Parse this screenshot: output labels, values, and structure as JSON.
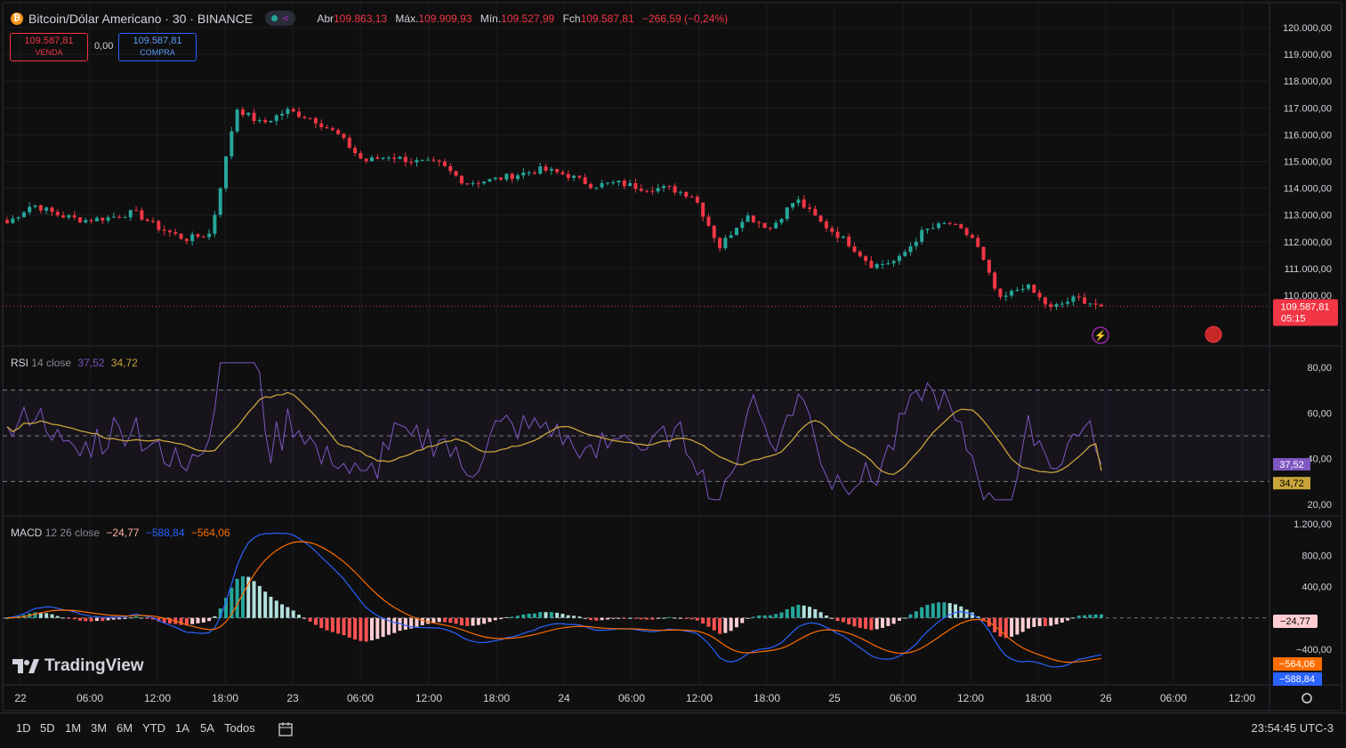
{
  "header": {
    "symbol": "Bitcoin/Dólar Americano · 30 · BINANCE",
    "coin_glyph": "₿",
    "open_label": "Abr",
    "open": "109.863,13",
    "high_label": "Máx.",
    "high": "109.909,93",
    "low_label": "Mín.",
    "low": "109.527,99",
    "close_label": "Fch",
    "close": "109.587,81",
    "change": "−266,59 (−0,24%)"
  },
  "trade": {
    "sell_price": "109.587,81",
    "sell_label": "VENDA",
    "spread": "0,00",
    "buy_price": "109.587,81",
    "buy_label": "COMPRA"
  },
  "price_axis": [
    "120.000,00",
    "119.000,00",
    "118.000,00",
    "117.000,00",
    "116.000,00",
    "115.000,00",
    "114.000,00",
    "113.000,00",
    "112.000,00",
    "111.000,00",
    "110.000,00"
  ],
  "last_price": {
    "value": "109.587,81",
    "countdown": "05:15"
  },
  "rsi": {
    "title": "RSI",
    "params": "14 close",
    "value1": "37,52",
    "value2": "34,72",
    "axis": [
      "80,00",
      "60,00",
      "40,00",
      "20,00"
    ]
  },
  "macd": {
    "title": "MACD",
    "params": "12 26 close",
    "hist": "−24,77",
    "macd": "−588,84",
    "signal": "−564,06",
    "axis": [
      "1.200,00",
      "800,00",
      "400,00",
      "−400,00"
    ]
  },
  "time_axis": [
    "22",
    "06:00",
    "12:00",
    "18:00",
    "23",
    "06:00",
    "12:00",
    "18:00",
    "24",
    "06:00",
    "12:00",
    "18:00",
    "25",
    "06:00",
    "12:00",
    "18:00",
    "26",
    "06:00",
    "12:00"
  ],
  "branding": "TradingView",
  "ranges": [
    "1D",
    "5D",
    "1M",
    "3M",
    "6M",
    "YTD",
    "1A",
    "5A",
    "Todos"
  ],
  "clock": "23:54:45 UTC-3",
  "colors": {
    "up": "#26a69a",
    "down": "#f23645",
    "rsi": "#7e57c2",
    "rsi_ma": "#c9a43a",
    "macd": "#2962ff",
    "signal": "#ff6d00"
  },
  "chart_data": {
    "type": "candlestick",
    "title": "Bitcoin/Dólar Americano · 30 · BINANCE",
    "ylim": [
      109000,
      120300
    ],
    "approx_close_path": [
      112700,
      113400,
      113000,
      112800,
      112900,
      113100,
      112500,
      112100,
      112300,
      117000,
      116400,
      116900,
      116600,
      116000,
      115000,
      115200,
      115000,
      114900,
      114200,
      114300,
      114500,
      114700,
      114500,
      114100,
      114200,
      114000,
      114000,
      113700,
      111800,
      113000,
      112500,
      113600,
      112700,
      112000,
      111100,
      111300,
      112400,
      112700,
      112100,
      109800,
      110400,
      109500,
      109900,
      109588
    ],
    "last": 109587.81
  }
}
